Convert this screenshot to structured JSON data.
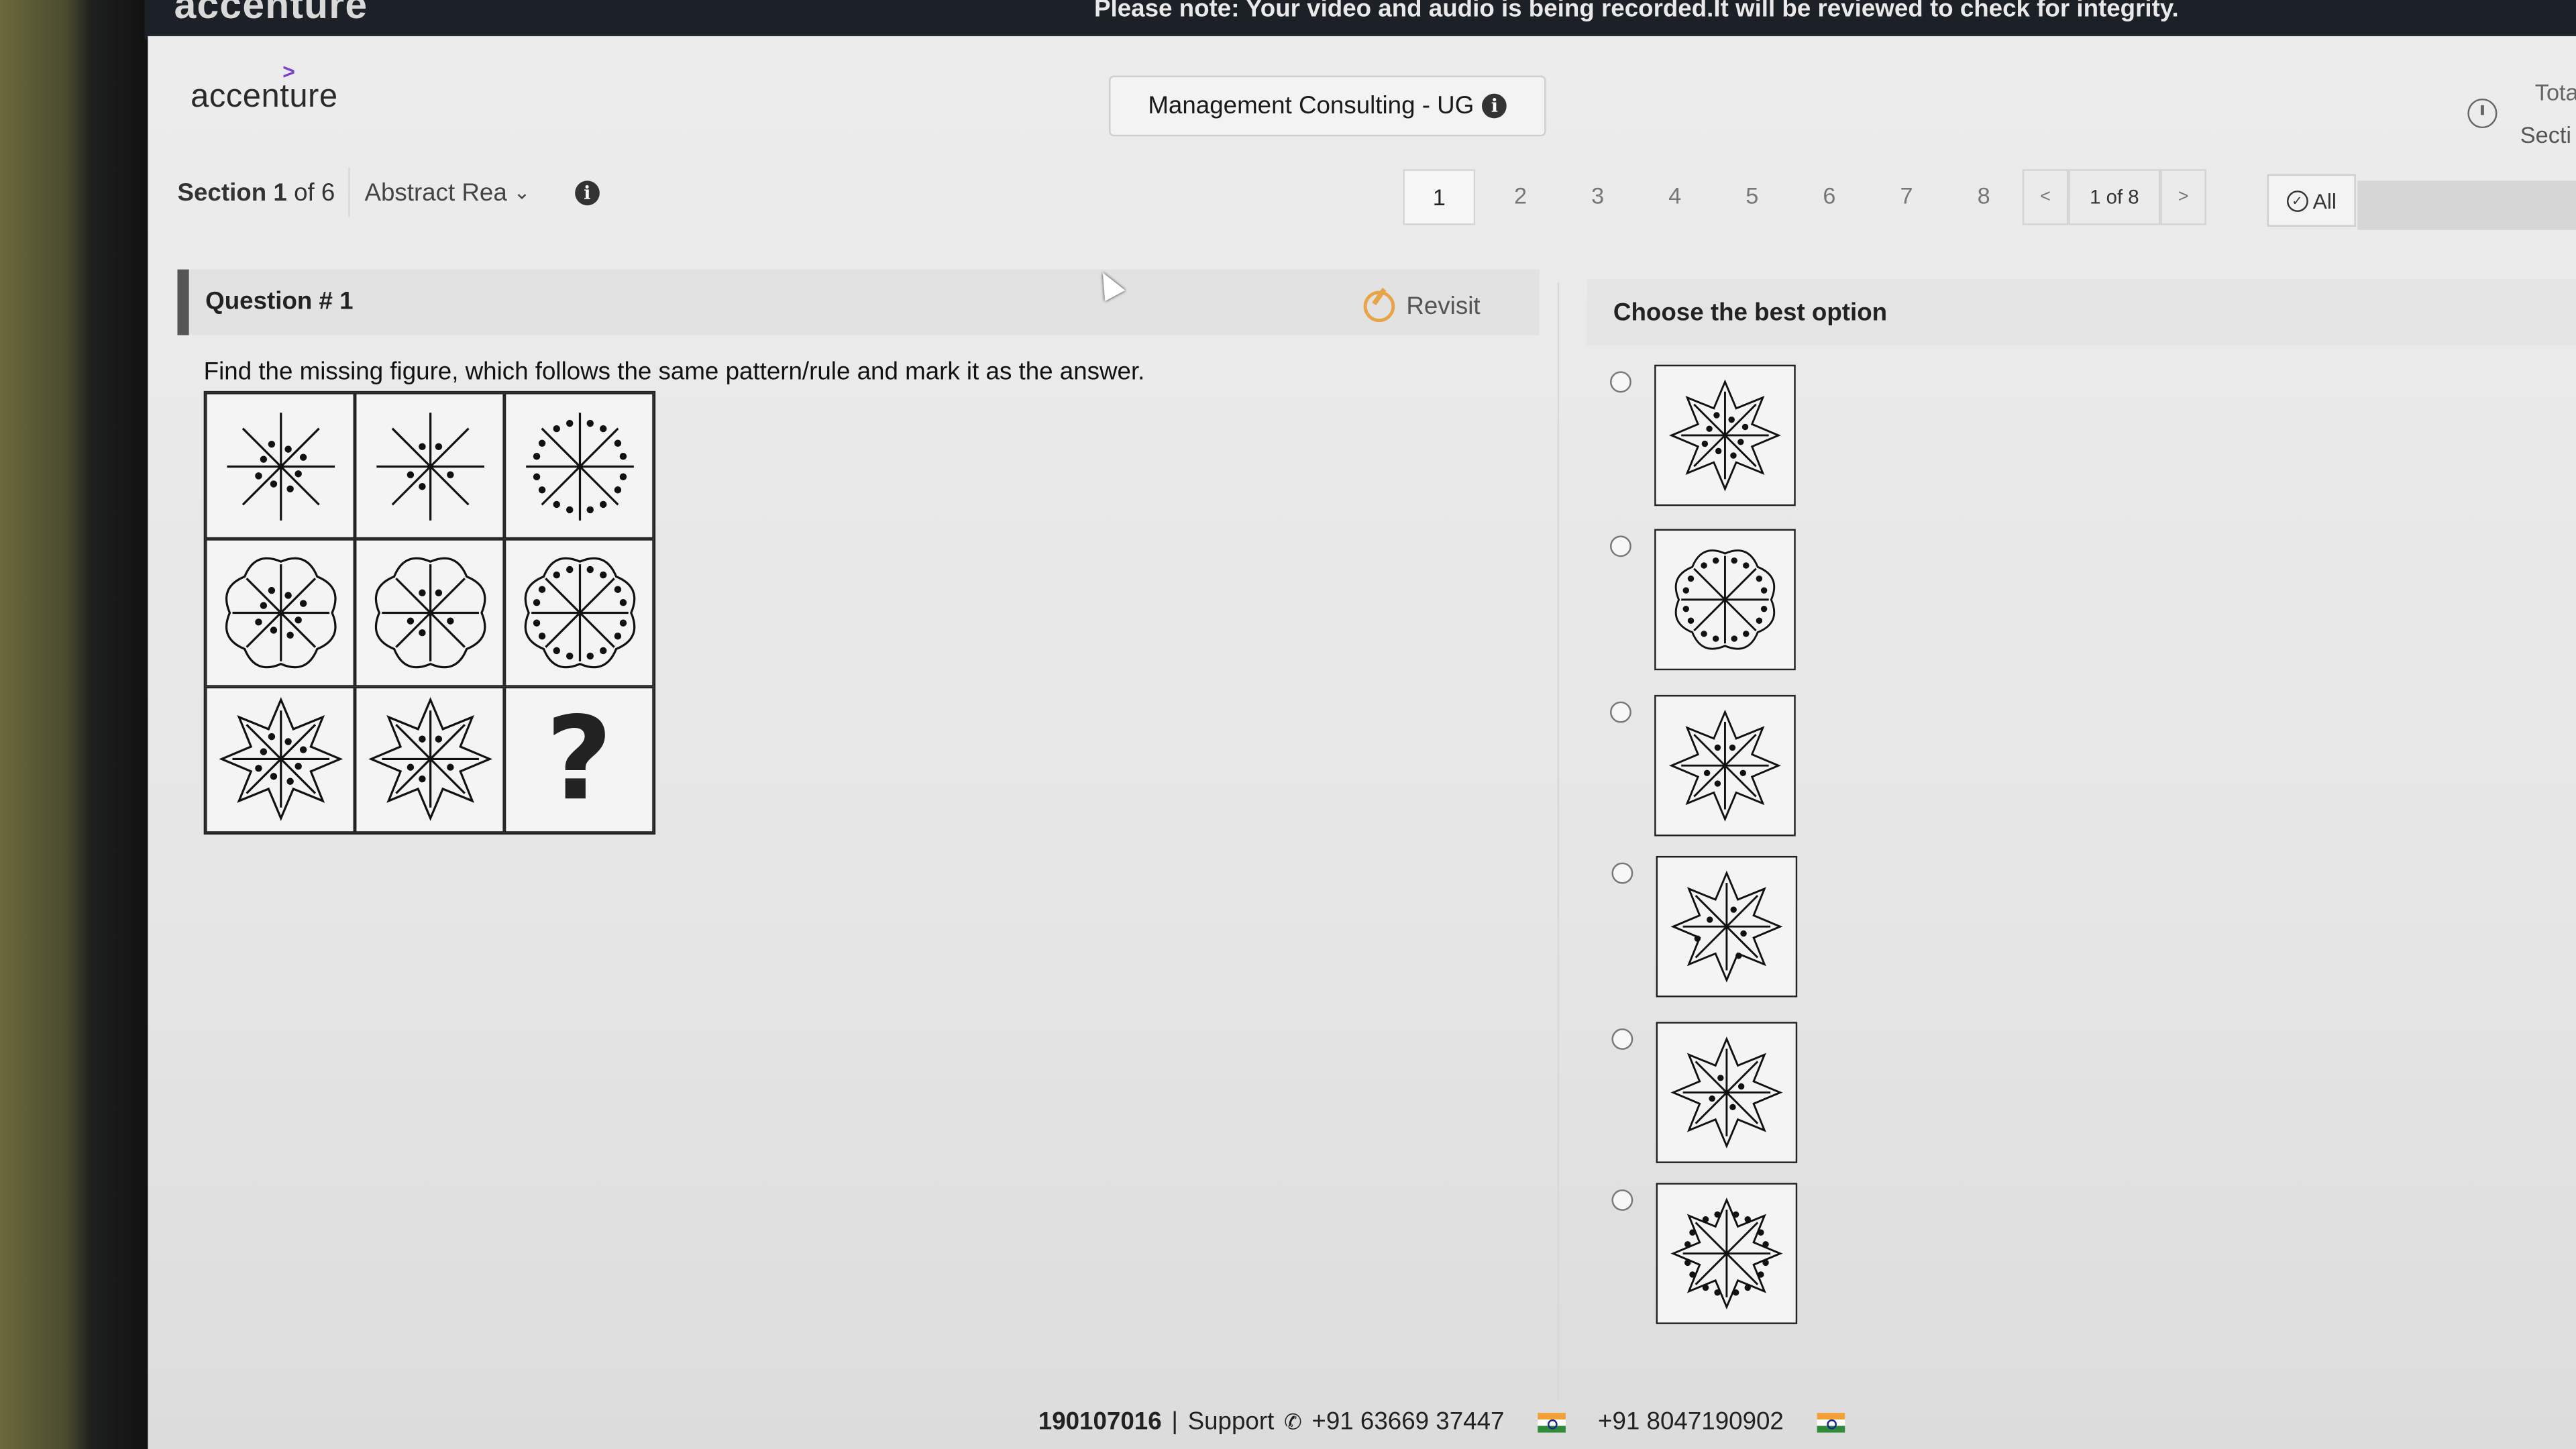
{
  "topbar": {
    "brand": "accenture",
    "notice": "Please note: Your video and audio is being recorded.It will be reviewed to check for integrity."
  },
  "header": {
    "logo": "accenture",
    "course": "Management Consulting - UG",
    "timer_labels": [
      "Tota",
      "Secti"
    ]
  },
  "section": {
    "label": "Section",
    "current": "1",
    "of_text": "of 6",
    "select_value": "Abstract Rea"
  },
  "pagination": {
    "pages": [
      "1",
      "2",
      "3",
      "4",
      "5",
      "6",
      "7",
      "8"
    ],
    "active_page": "1",
    "prev": "<",
    "counter": "1 of 8",
    "next": ">",
    "all_label": "All"
  },
  "question": {
    "title": "Question # 1",
    "revisit_label": "Revisit",
    "instruction": "Find the missing figure, which follows the same pattern/rule and mark it as the answer.",
    "missing_symbol": "?",
    "grid": [
      {
        "shape": "asterisk",
        "dots": "inner"
      },
      {
        "shape": "asterisk",
        "dots": "inner-partial"
      },
      {
        "shape": "asterisk",
        "dots": "outer-ring"
      },
      {
        "shape": "flower",
        "dots": "inner"
      },
      {
        "shape": "flower",
        "dots": "inner-partial"
      },
      {
        "shape": "flower",
        "dots": "outer-ring"
      },
      {
        "shape": "star",
        "dots": "inner"
      },
      {
        "shape": "star",
        "dots": "inner-partial"
      },
      {
        "shape": "missing",
        "dots": "none"
      }
    ]
  },
  "options": {
    "heading": "Choose the best option",
    "items": [
      {
        "shape": "star",
        "dots": "inner"
      },
      {
        "shape": "flower",
        "dots": "outer-ring"
      },
      {
        "shape": "star",
        "dots": "inner-partial"
      },
      {
        "shape": "star",
        "dots": "mixed"
      },
      {
        "shape": "star",
        "dots": "center"
      },
      {
        "shape": "star",
        "dots": "outer-ring"
      }
    ]
  },
  "footer": {
    "id": "190107016",
    "separator": "|",
    "support_label": "Support",
    "phone1": "+91 63669 37447",
    "phone2": "+91 8047190902"
  }
}
